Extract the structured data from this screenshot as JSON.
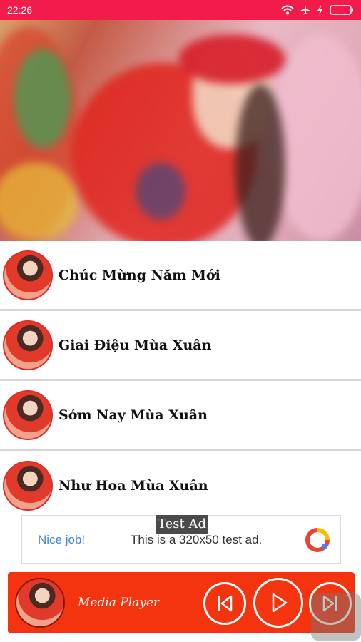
{
  "status_bar": {
    "time": "22:26",
    "icons": [
      "wifi-icon",
      "airplane-icon",
      "charging-icon",
      "battery-icon"
    ],
    "color": "#f21c4a"
  },
  "hero": {
    "image": "hero-photo"
  },
  "songs": [
    {
      "title": "Chúc Mừng Năm Mới"
    },
    {
      "title": "Giai Điệu Mùa Xuân"
    },
    {
      "title": "Sớm Nay Mùa Xuân"
    },
    {
      "title": "Như Hoa Mùa Xuân"
    }
  ],
  "ad": {
    "badge": "Test Ad",
    "nice": "Nice job!",
    "text": "This is a 320x50 test ad."
  },
  "player": {
    "title": "Media Player",
    "color": "#f4330f",
    "controls": [
      "previous-icon",
      "play-icon",
      "next-icon"
    ]
  }
}
